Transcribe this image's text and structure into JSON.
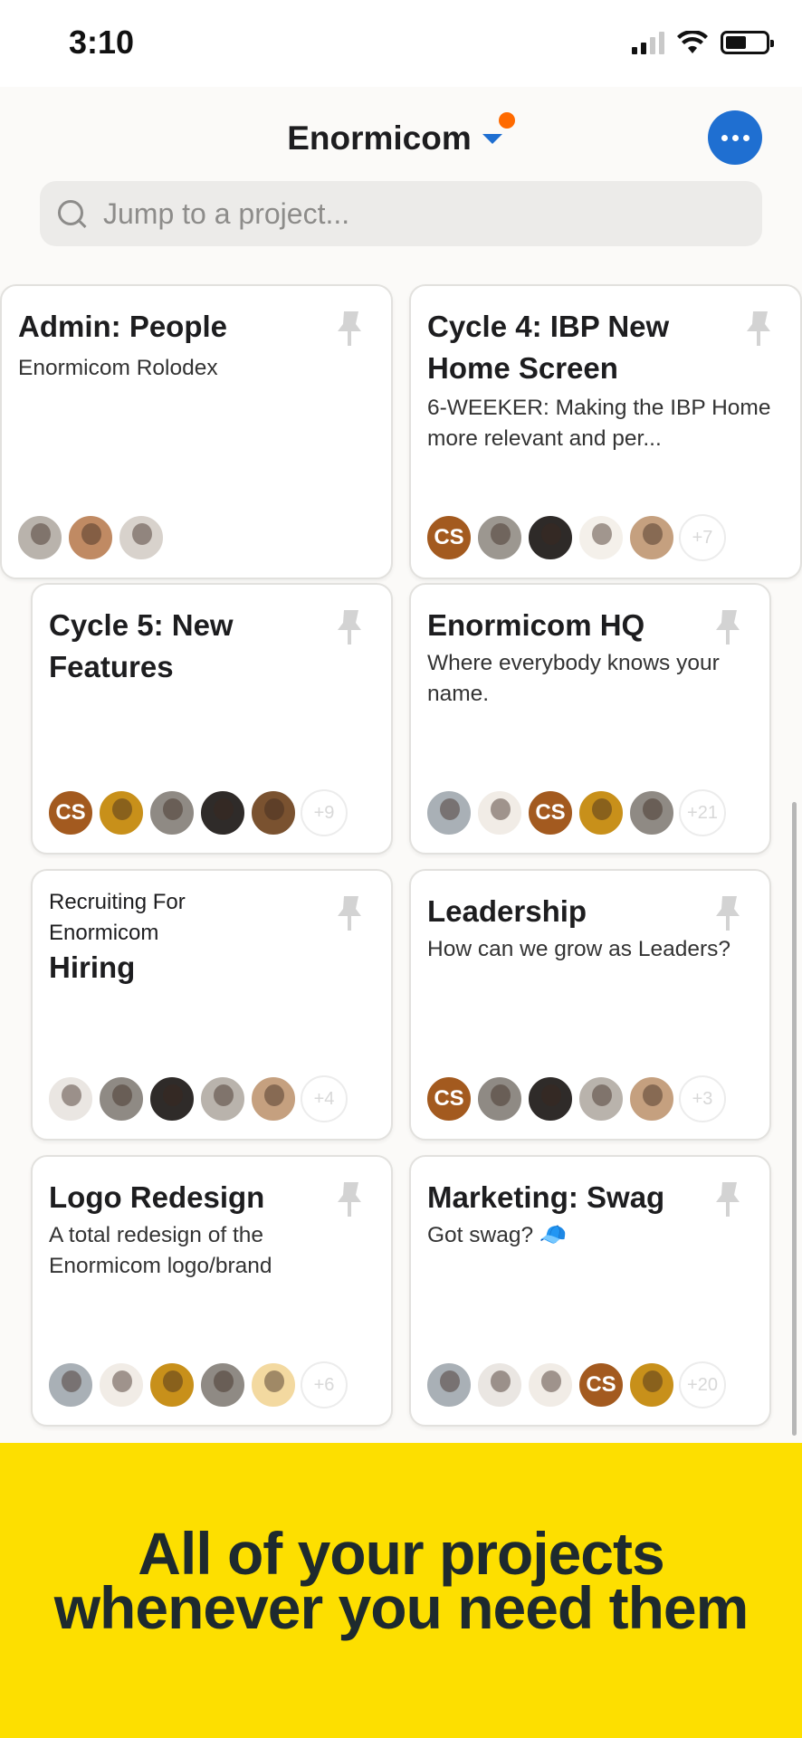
{
  "status": {
    "time": "3:10"
  },
  "header": {
    "title": "Enormicom"
  },
  "search": {
    "placeholder": "Jump to a project..."
  },
  "cards": [
    {
      "title": "Admin: People",
      "pre": "",
      "desc": "Enormicom Rolodex",
      "avatars": [
        "photo",
        "photo",
        "photo"
      ],
      "more": ""
    },
    {
      "title": "Cycle 4: IBP New Home Screen",
      "pre": "",
      "desc": "6-WEEKER: Making the IBP Home more relevant and per...",
      "avatars": [
        "CS",
        "photo",
        "photo",
        "photo",
        "photo"
      ],
      "more": "+7"
    },
    {
      "title": "Cycle 5: New Features",
      "pre": "",
      "desc": "",
      "avatars": [
        "CS",
        "photo",
        "photo",
        "photo",
        "photo"
      ],
      "more": "+9"
    },
    {
      "title": "Enormicom HQ",
      "pre": "",
      "desc": "Where everybody knows your name.",
      "avatars": [
        "photo",
        "photo",
        "CS",
        "photo",
        "photo"
      ],
      "more": "+21"
    },
    {
      "title": "Hiring",
      "pre": "Recruiting For Enormicom",
      "desc": "",
      "avatars": [
        "photo",
        "photo",
        "photo",
        "photo",
        "photo"
      ],
      "more": "+4"
    },
    {
      "title": "Leadership",
      "pre": "",
      "desc": "How can we grow as Leaders?",
      "avatars": [
        "CS",
        "photo",
        "photo",
        "photo",
        "photo"
      ],
      "more": "+3"
    },
    {
      "title": "Logo Redesign",
      "pre": "",
      "desc": "A total redesign of the Enormicom logo/brand",
      "avatars": [
        "photo",
        "photo",
        "photo",
        "photo",
        "photo"
      ],
      "more": "+6"
    },
    {
      "title": "Marketing: Swag",
      "pre": "",
      "desc": "Got swag? 🧢",
      "avatars": [
        "photo",
        "photo",
        "photo",
        "CS",
        "photo"
      ],
      "more": "+20"
    }
  ],
  "promo": {
    "line1": "All of your projects",
    "line2": "whenever you need them"
  },
  "colors": {
    "accent": "#1f6fd1",
    "notification": "#ff6a00",
    "promo_bg": "#fddf00",
    "avatar_cs": "#a35a1f"
  }
}
